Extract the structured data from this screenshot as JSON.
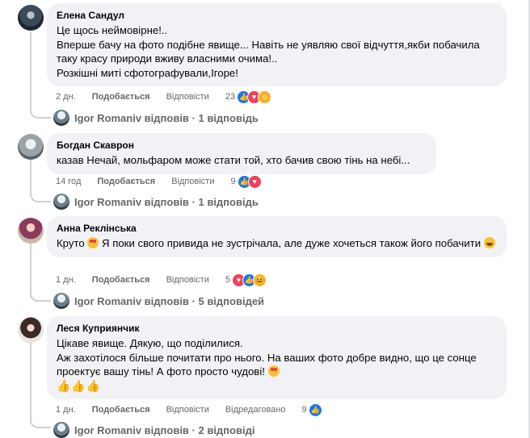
{
  "comments": [
    {
      "author": "Елена Сандул",
      "text": "Це щось неймовірне!..\nВперше бачу на фото подібне явище... Навіть не уявляю свої відчуття,якби побачила таку красу природи вживу власними очима!..\nРозкішні миті сфотографували,Ігоре!",
      "time": "2 дн.",
      "like_label": "Подобається",
      "reply_label": "Відповісти",
      "reaction_count": "23",
      "reaction_icons": [
        "like-icon",
        "love-icon",
        "care-icon"
      ],
      "replies_text": "Igor Romaniv відповів · 1 відповідь"
    },
    {
      "author": "Богдан Скаврон",
      "text": "казав Нечай, мольфаром може стати той, хто бачив свою тінь на небі...",
      "time": "14 год",
      "like_label": "Подобається",
      "reply_label": "Відповісти",
      "reaction_count": "9",
      "reaction_icons": [
        "like-icon",
        "love-icon"
      ],
      "replies_text": "Igor Romaniv відповів · 1 відповідь"
    },
    {
      "author": "Анна Реклінська",
      "text_before": "Круто ",
      "text_after": " Я поки свого привида не зустрічала, але дуже хочеться також його побачити ",
      "time": "1 дн.",
      "like_label": "Подобається",
      "reply_label": "Відповісти",
      "reaction_count": "5",
      "reaction_icons": [
        "love-icon",
        "like-icon",
        "haha-icon"
      ],
      "replies_text": "Igor Romaniv відповів · 5 відповідей"
    },
    {
      "author": "Леся Куприянчик",
      "text": "Цікаве явище. Дякую, що поділилися.\nАж захотілося більше почитати про нього. На ваших фото добре видно, що це сонце проектує вашу тінь! А фото просто чудові! ",
      "hands": "👍👍👍",
      "time": "1 дн.",
      "like_label": "Подобається",
      "reply_label": "Відповісти",
      "edited_label": "Відредаговано",
      "reaction_count": "9",
      "reaction_icons": [
        "like-icon"
      ],
      "replies_text": "Igor Romaniv відповів · 2 відповіді"
    }
  ]
}
